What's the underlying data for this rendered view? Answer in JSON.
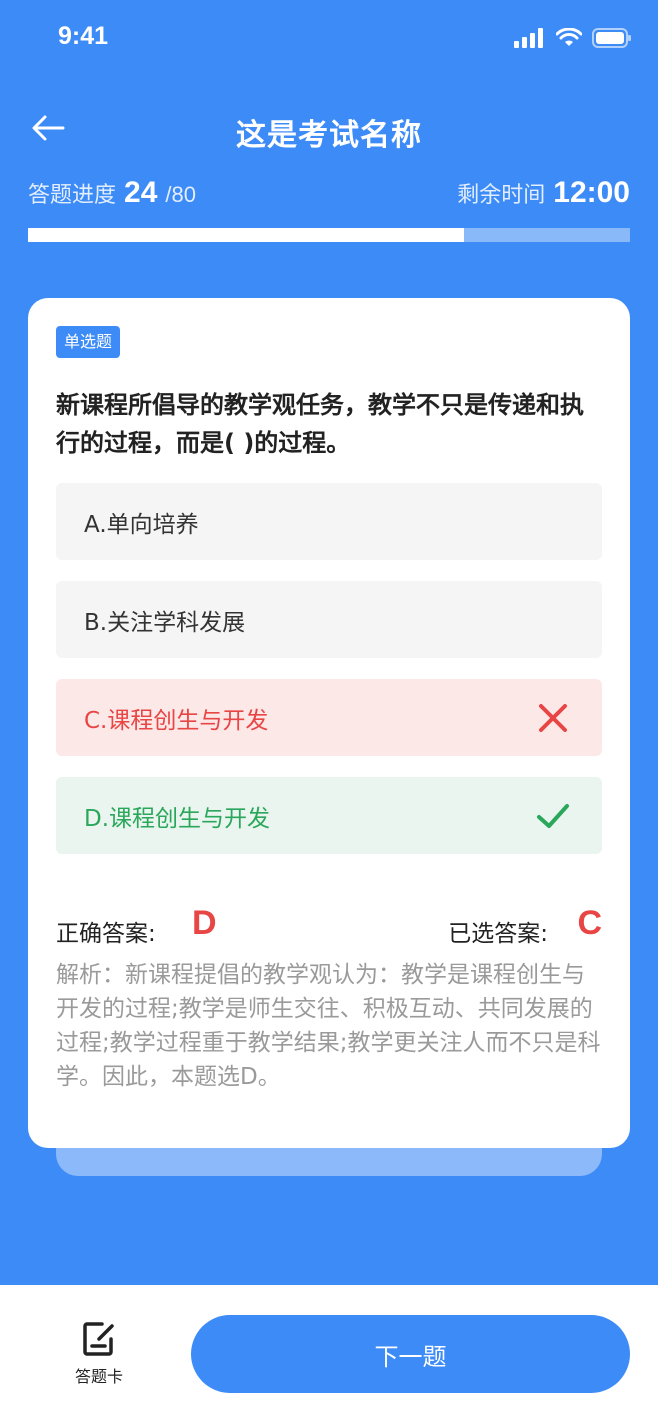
{
  "status": {
    "time": "9:41"
  },
  "header": {
    "title": "这是考试名称"
  },
  "progress": {
    "label": "答题进度",
    "current": "24",
    "total": "/80",
    "fraction": 0.725
  },
  "timer": {
    "label": "剩余时间",
    "value": "12:00"
  },
  "question": {
    "type": "单选题",
    "text": "新课程所倡导的教学观任务，教学不只是传递和执行的过程，而是( )的过程。",
    "options": [
      {
        "label": "A.单向培养",
        "state": "normal"
      },
      {
        "label": "B.关注学科发展",
        "state": "normal"
      },
      {
        "label": "C.课程创生与开发",
        "state": "wrong"
      },
      {
        "label": "D.课程创生与开发",
        "state": "right"
      }
    ]
  },
  "answer": {
    "correct_label": "正确答案:",
    "correct_value": "D",
    "selected_label": "已选答案:",
    "selected_value": "C",
    "analysis": "解析：新课程提倡的教学观认为：教学是课程创生与开发的过程;教学是师生交往、积极互动、共同发展的过程;教学过程重于教学结果;教学更关注人而不只是科学。因此，本题选D。"
  },
  "bottom": {
    "card_label": "答题卡",
    "next_label": "下一题"
  },
  "colors": {
    "primary": "#3d8bf7",
    "wrong": "#e84545",
    "right": "#2ba75c"
  },
  "icons": {
    "back": "arrow-left-icon",
    "wrong": "close-icon",
    "right": "check-icon",
    "answer_card": "edit-card-icon"
  }
}
